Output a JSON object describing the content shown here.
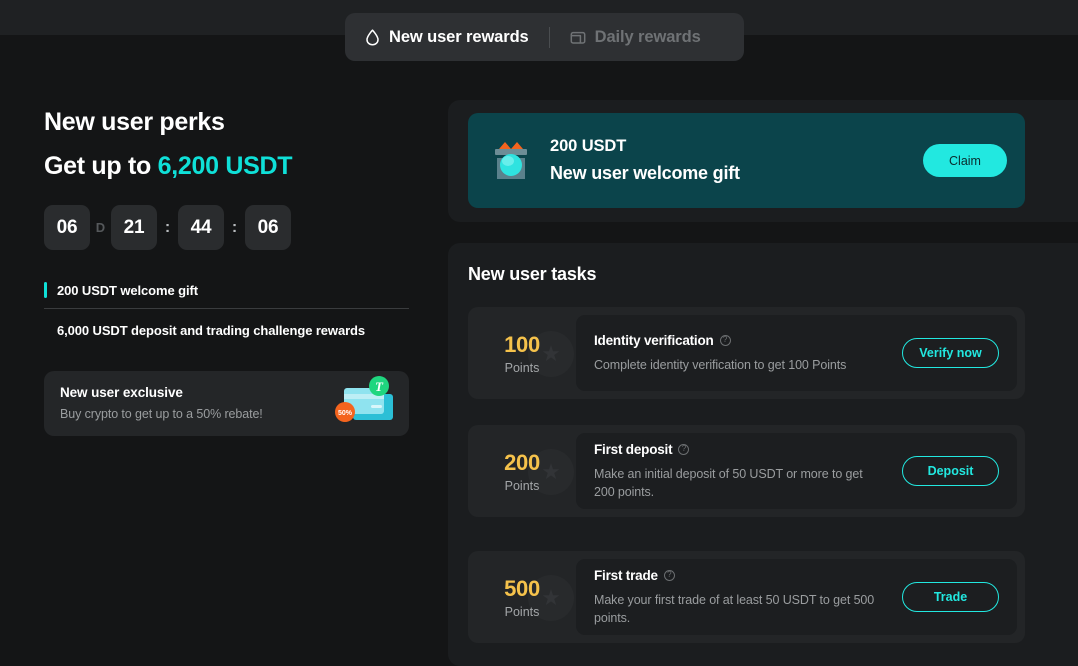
{
  "tabs": [
    {
      "label": "New user rewards",
      "icon": "flame-icon",
      "active": true
    },
    {
      "label": "Daily rewards",
      "icon": "wallet-icon",
      "active": false
    }
  ],
  "left": {
    "heading": "New user perks",
    "subheading_prefix": "Get up to ",
    "subheading_amount": "6,200 USDT",
    "timer": {
      "days": "06",
      "days_unit": "D",
      "hours": "21",
      "sep1": ":",
      "minutes": "44",
      "sep2": ":",
      "seconds": "06"
    },
    "perks": [
      "200 USDT welcome gift",
      "6,000 USDT deposit and trading challenge rewards"
    ],
    "exclusive": {
      "title": "New user exclusive",
      "subtitle": "Buy crypto to get up to a 50% rebate!",
      "badge_percent": "50%",
      "badge_token": "T"
    }
  },
  "banner": {
    "amount": "200 USDT",
    "title": "New user welcome gift",
    "button": "Claim"
  },
  "tasks_section": {
    "title": "New user tasks",
    "tasks": [
      {
        "points": "100",
        "points_label": "Points",
        "title": "Identity verification",
        "help": "?",
        "description": "Complete identity verification to get 100 Points",
        "button": "Verify now"
      },
      {
        "points": "200",
        "points_label": "Points",
        "title": "First deposit",
        "help": "?",
        "description": "Make an initial deposit of 50 USDT or more to get 200 points.",
        "button": "Deposit"
      },
      {
        "points": "500",
        "points_label": "Points",
        "title": "First trade",
        "help": "?",
        "description": "Make your first trade of at least 50 USDT to get 500 points.",
        "button": "Trade"
      }
    ]
  },
  "colors": {
    "accent": "#22e8e0",
    "accent_text": "#0fe0d8",
    "points": "#f5c24b",
    "banner_bg": "#0b444b",
    "page_bg": "#141516",
    "panel_bg": "#1b1d1f",
    "card_bg": "#232527"
  }
}
